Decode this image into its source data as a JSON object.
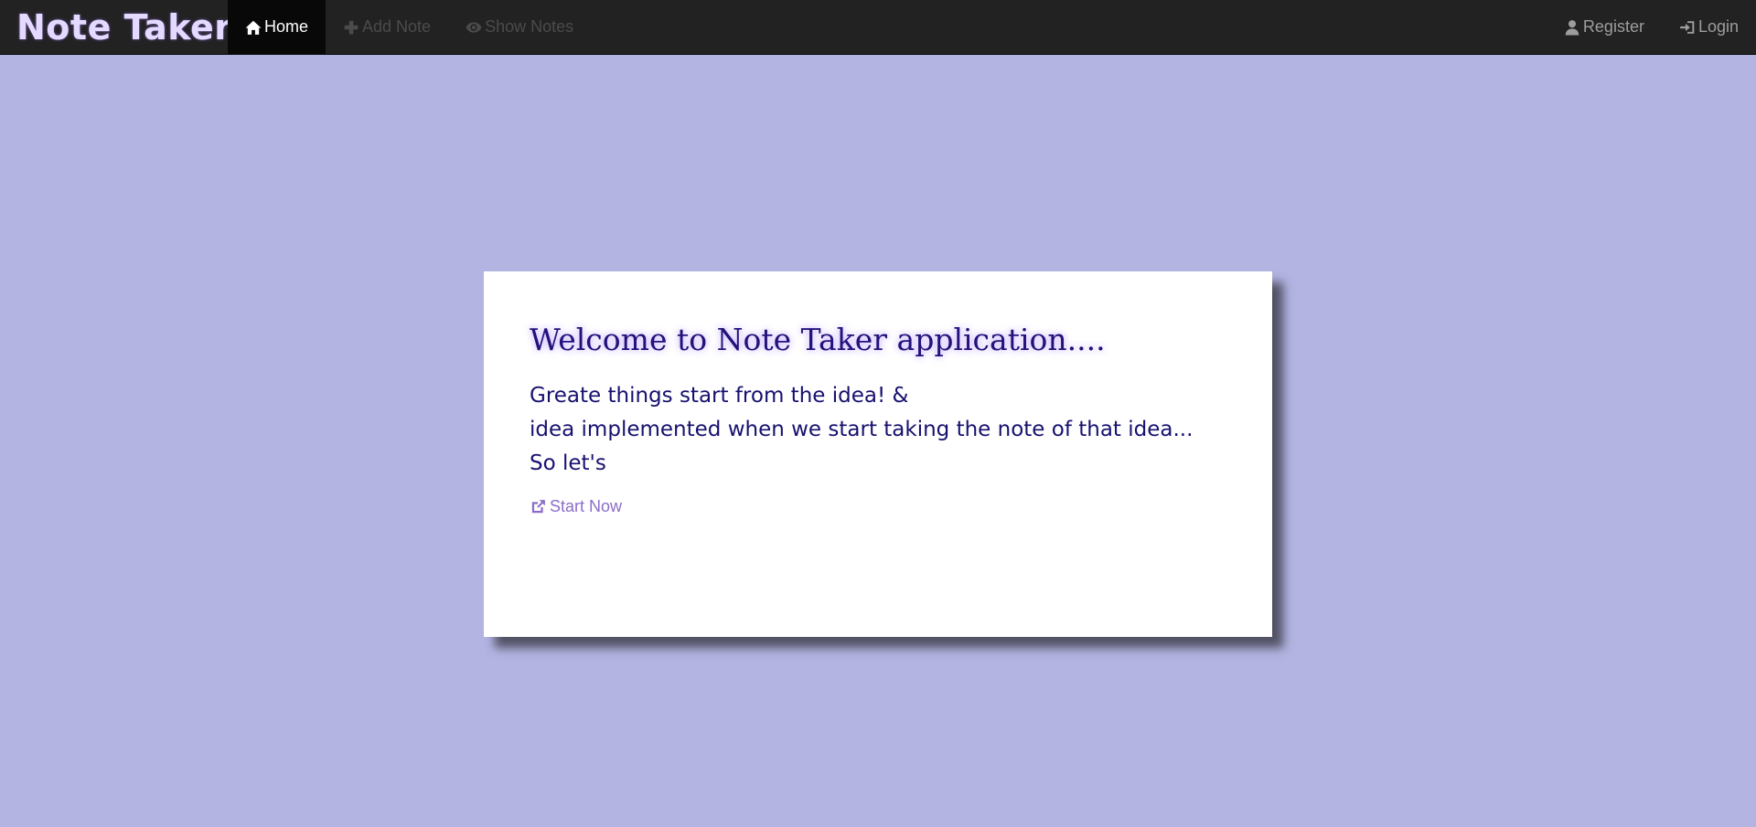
{
  "navbar": {
    "brand": "Note Taker",
    "left_items": [
      {
        "label": "Home",
        "icon": "home-icon"
      },
      {
        "label": "Add Note",
        "icon": "plus-icon"
      },
      {
        "label": "Show Notes",
        "icon": "eye-icon"
      }
    ],
    "right_items": [
      {
        "label": "Register",
        "icon": "user-icon"
      },
      {
        "label": "Login",
        "icon": "login-icon"
      }
    ]
  },
  "card": {
    "title": "Welcome to Note Taker application....",
    "lines": [
      "Greate things start from the idea! &",
      "idea implemented when we start taking the note of that idea...",
      "So let's"
    ],
    "link_label": "Start Now",
    "link_icon": "external-link-icon"
  },
  "colors": {
    "background": "#b3b4e2",
    "navbar": "#222222",
    "brand": "#e4d9ff",
    "title": "#22127a",
    "text": "#17116f",
    "link": "#8c6dc9"
  }
}
